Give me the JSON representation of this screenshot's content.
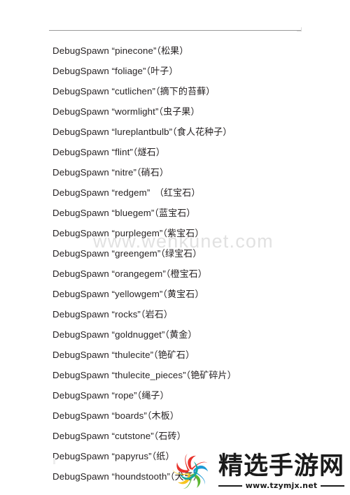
{
  "document": {
    "background_color": "#ffffff",
    "text_color": "#231f20",
    "rule_color": "#9a9a9a"
  },
  "watermark": {
    "text": "www.wenkunet.com",
    "color": "#d8d8d8"
  },
  "commands": [
    {
      "command": "DebugSpawn",
      "code": "“pinecone”",
      "zh": "（松果）",
      "extra_gap": false
    },
    {
      "command": "DebugSpawn",
      "code": "“foliage”",
      "zh": "（叶子）",
      "extra_gap": false
    },
    {
      "command": "DebugSpawn",
      "code": "“cutlichen”",
      "zh": "（摘下的苔藓）",
      "extra_gap": false
    },
    {
      "command": "DebugSpawn",
      "code": "“wormlight”",
      "zh": "（虫子果）",
      "extra_gap": false
    },
    {
      "command": "DebugSpawn",
      "code": "“lureplantbulb”",
      "zh": "（食人花种子）",
      "extra_gap": false
    },
    {
      "command": "DebugSpawn",
      "code": "“flint”",
      "zh": "（燧石）",
      "extra_gap": false
    },
    {
      "command": "DebugSpawn",
      "code": "“nitre”",
      "zh": "（硝石）",
      "extra_gap": false
    },
    {
      "command": "DebugSpawn",
      "code": "“redgem”",
      "zh": "（红宝石）",
      "extra_gap": true
    },
    {
      "command": "DebugSpawn",
      "code": "“bluegem”",
      "zh": "（蓝宝石）",
      "extra_gap": false
    },
    {
      "command": "DebugSpawn",
      "code": "“purplegem”",
      "zh": "（紫宝石）",
      "extra_gap": false
    },
    {
      "command": "DebugSpawn",
      "code": "“greengem”",
      "zh": "（绿宝石）",
      "extra_gap": false
    },
    {
      "command": "DebugSpawn",
      "code": "“orangegem”",
      "zh": "（橙宝石）",
      "extra_gap": false
    },
    {
      "command": "DebugSpawn",
      "code": "“yellowgem”",
      "zh": "（黄宝石）",
      "extra_gap": false
    },
    {
      "command": "DebugSpawn",
      "code": "“rocks”",
      "zh": "（岩石）",
      "extra_gap": false
    },
    {
      "command": "DebugSpawn",
      "code": "“goldnugget”",
      "zh": "（黄金）",
      "extra_gap": false
    },
    {
      "command": "DebugSpawn",
      "code": "“thulecite”",
      "zh": "（铯矿石）",
      "extra_gap": false
    },
    {
      "command": "DebugSpawn",
      "code": "“thulecite_pieces”",
      "zh": "（铯矿碎片）",
      "extra_gap": false
    },
    {
      "command": "DebugSpawn",
      "code": "“rope”",
      "zh": "（绳子）",
      "extra_gap": false
    },
    {
      "command": "DebugSpawn",
      "code": "“boards”",
      "zh": "（木板）",
      "extra_gap": false
    },
    {
      "command": "DebugSpawn",
      "code": "“cutstone”",
      "zh": "（石砖）",
      "extra_gap": false
    },
    {
      "command": "DebugSpawn",
      "code": "“papyrus”",
      "zh": "（纸）",
      "extra_gap": false
    },
    {
      "command": "DebugSpawn",
      "code": "“houndstooth”",
      "zh": "（犬牙）",
      "extra_gap": false
    }
  ],
  "brand": {
    "name": "精选手游网",
    "url": "www.tzymjx.net",
    "logo_colors": {
      "red": "#e8322b",
      "yellow": "#f7c51e",
      "green": "#5cb531",
      "blue": "#1c9ad6",
      "teal": "#14a8a0"
    }
  }
}
